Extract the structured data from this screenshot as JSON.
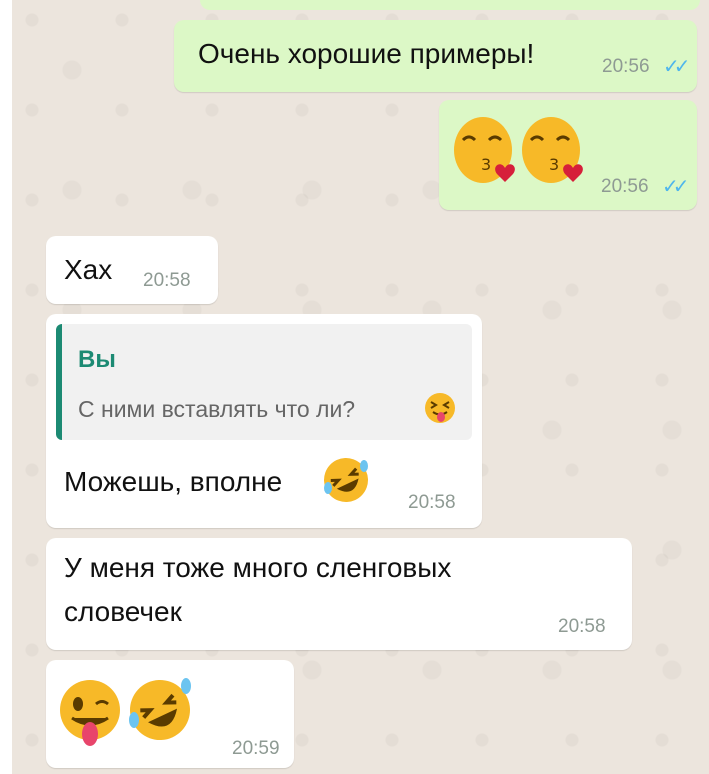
{
  "messages": {
    "m1": {
      "text": "Очень хорошие примеры!",
      "time": "20:56",
      "ticks": "✓✓"
    },
    "m2": {
      "emojis": [
        "kissing-face-heart-icon",
        "kissing-face-heart-icon"
      ],
      "time": "20:56",
      "ticks": "✓✓"
    },
    "m3": {
      "text": "Хах",
      "time": "20:58"
    },
    "m4": {
      "reply_name": "Вы",
      "reply_text": "С ними вставлять что ли?",
      "reply_emoji": "tongue-out-face-icon",
      "text": "Можешь, вполне",
      "text_emoji": "rolling-laughing-face-icon",
      "time": "20:58"
    },
    "m5": {
      "line1": "У меня тоже много сленговых",
      "line2": "словечек",
      "time": "20:58"
    },
    "m6": {
      "emojis": [
        "winking-tongue-face-icon",
        "rolling-laughing-face-icon"
      ],
      "time": "20:59"
    }
  },
  "colors": {
    "outgoing_bubble": "#dcf8c6",
    "incoming_bubble": "#ffffff",
    "chat_background": "#ece5dd",
    "read_ticks": "#4fb6ec",
    "reply_accent": "#1c8a73"
  }
}
